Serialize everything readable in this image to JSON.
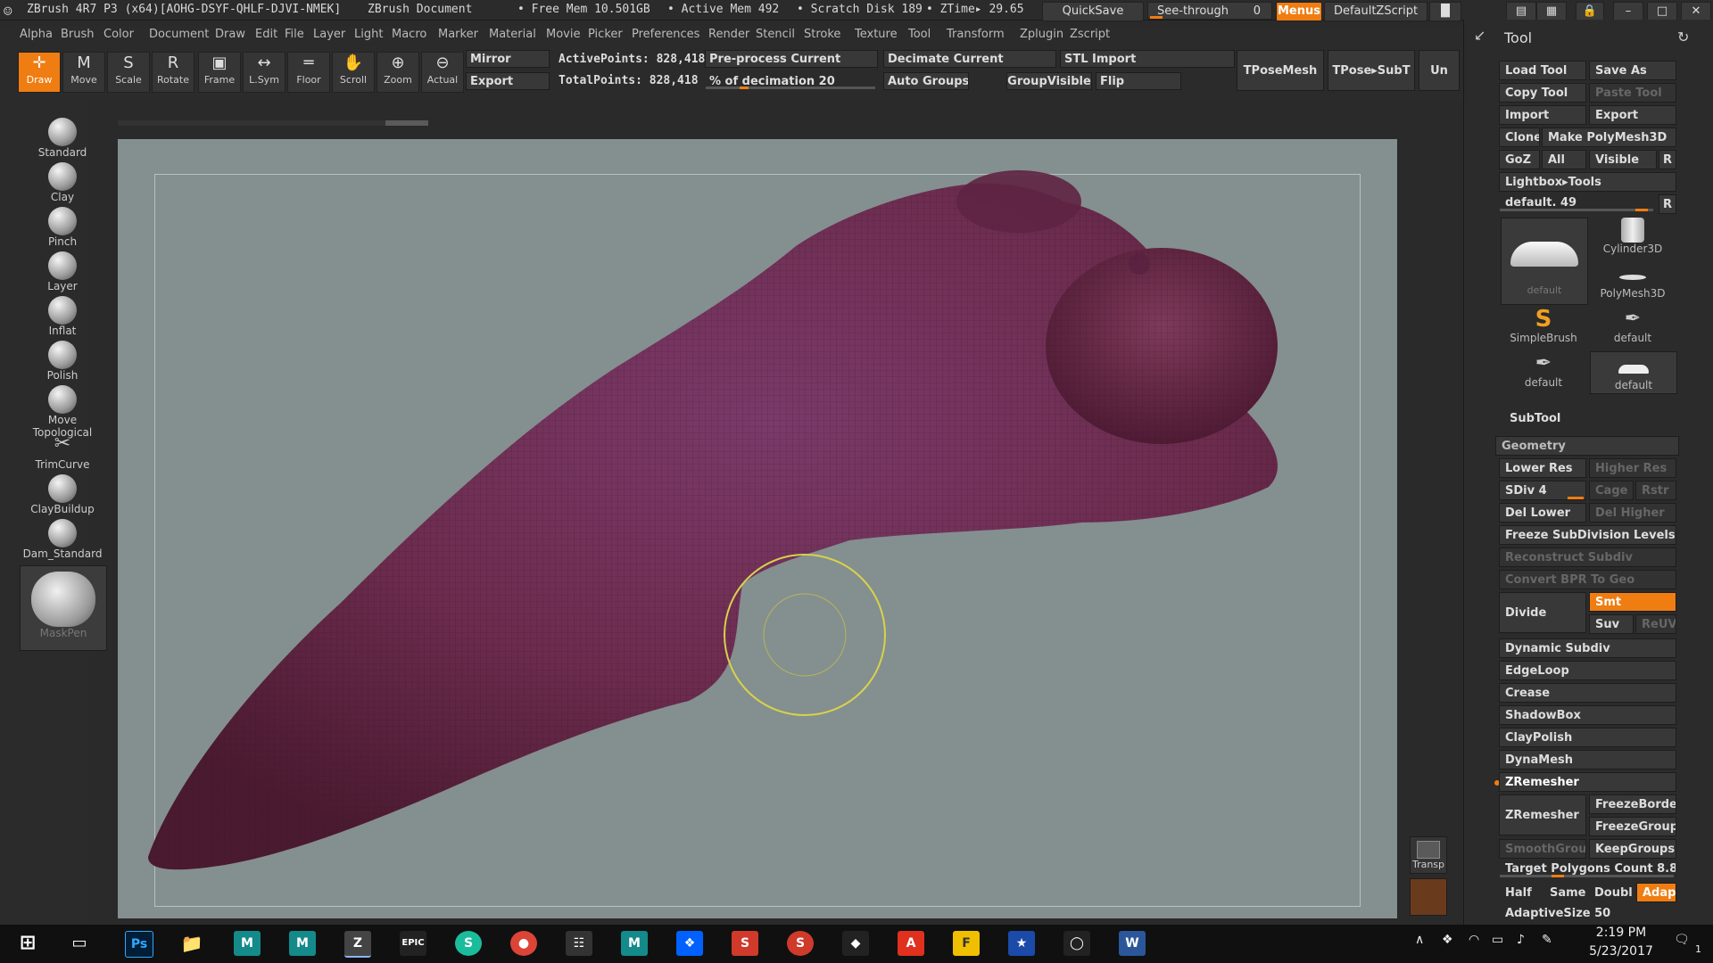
{
  "titlebar": {
    "app_title": "ZBrush 4R7 P3 (x64)[AOHG-DSYF-QHLF-DJVI-NMEK]",
    "doc_title": "ZBrush Document",
    "free_mem": "• Free Mem 10.501GB",
    "active_mem": "• Active Mem 492",
    "scratch": "• Scratch Disk 189",
    "ztime": "• ZTime▸ 29.65",
    "quicksave": "QuickSave",
    "seethrough": "See-through",
    "seethrough_value": "0",
    "menus": "Menus",
    "script": "DefaultZScript"
  },
  "menubar": [
    "Alpha",
    "Brush",
    "Color",
    "Document",
    "Draw",
    "Edit",
    "File",
    "Layer",
    "Light",
    "Macro",
    "Marker",
    "Material",
    "Movie",
    "Picker",
    "Preferences",
    "Render",
    "Stencil",
    "Stroke",
    "Texture",
    "Tool",
    "Transform",
    "Zplugin",
    "Zscript"
  ],
  "shelf": {
    "buttons": [
      {
        "label": "Draw",
        "icon": "✛",
        "active": true
      },
      {
        "label": "Move",
        "icon": "M"
      },
      {
        "label": "Scale",
        "icon": "S"
      },
      {
        "label": "Rotate",
        "icon": "R"
      },
      {
        "label": "Frame",
        "icon": "▣"
      },
      {
        "label": "L.Sym",
        "icon": "↔"
      },
      {
        "label": "Floor",
        "icon": "═"
      },
      {
        "label": "Scroll",
        "icon": "✋"
      },
      {
        "label": "Zoom",
        "icon": "⊕"
      },
      {
        "label": "Actual",
        "icon": "⊖"
      }
    ],
    "mirror": "Mirror",
    "export": "Export",
    "active_points": "ActivePoints: 828,418",
    "total_points": "TotalPoints: 828,418",
    "preprocess": "Pre-process Current",
    "decimation": "% of decimation 20",
    "decimation_pct": 20,
    "decimate": "Decimate Current",
    "autogroups": "Auto Groups",
    "stl_import": "STL Import",
    "groupvisible": "GroupVisible",
    "flip": "Flip",
    "tposemesh": "TPoseMesh",
    "tpose_subt": "TPose▸SubT",
    "un": "Un"
  },
  "brushes": [
    "Standard",
    "Clay",
    "Pinch",
    "Layer",
    "Inflat",
    "Polish",
    "Move Topological",
    "TrimCurve",
    "ClayBuildup",
    "Dam_Standard",
    "MaskPen"
  ],
  "side_buttons": {
    "transp": "Transp"
  },
  "rightpanel": {
    "title": "Tool",
    "load_tool": "Load Tool",
    "save_as": "Save As",
    "copy_tool": "Copy Tool",
    "paste_tool": "Paste Tool",
    "import": "Import",
    "export": "Export",
    "clone": "Clone",
    "make_polymesh": "Make PolyMesh3D",
    "goz": "GoZ",
    "all": "All",
    "visible": "Visible",
    "r": "R",
    "lightbox_tools": "Lightbox▸Tools",
    "default_slider": "default. 49",
    "tools": [
      "default",
      "Cylinder3D",
      "PolyMesh3D",
      "SimpleBrush",
      "default",
      "default",
      "default"
    ],
    "subtool": "SubTool",
    "geometry": "Geometry",
    "lower_res": "Lower Res",
    "higher_res": "Higher Res",
    "sdiv": "SDiv 4",
    "cage": "Cage",
    "rstr": "Rstr",
    "del_lower": "Del Lower",
    "del_higher": "Del Higher",
    "freeze_subdiv": "Freeze SubDivision Levels",
    "reconstruct": "Reconstruct Subdiv",
    "convert_bpr": "Convert BPR To Geo",
    "divide": "Divide",
    "smt": "Smt",
    "suv": "Suv",
    "reuv": "ReUV",
    "dynamic_subdiv": "Dynamic Subdiv",
    "edgeloop": "EdgeLoop",
    "crease": "Crease",
    "shadowbox": "ShadowBox",
    "claypolish": "ClayPolish",
    "dynamesh": "DynaMesh",
    "zremesher_header": "ZRemesher",
    "zremesher": "ZRemesher",
    "freezeborder": "FreezeBorde",
    "freezegroups": "FreezeGroup",
    "smoothgroups": "SmoothGrou",
    "keepgroups": "KeepGroups",
    "target_polys": "Target Polygons Count 8.8",
    "half": "Half",
    "same": "Same",
    "double": "Doubl",
    "adapt": "Adapt",
    "adaptive_size": "AdaptiveSize 50"
  },
  "taskbar": {
    "time": "2:19 PM",
    "date": "5/23/2017",
    "notif": "1"
  },
  "colors": {
    "accent": "#ef7d12",
    "viewport": "#848f90",
    "mesh": "#6e2a4a",
    "cursor_ring": "#d8d24a"
  }
}
